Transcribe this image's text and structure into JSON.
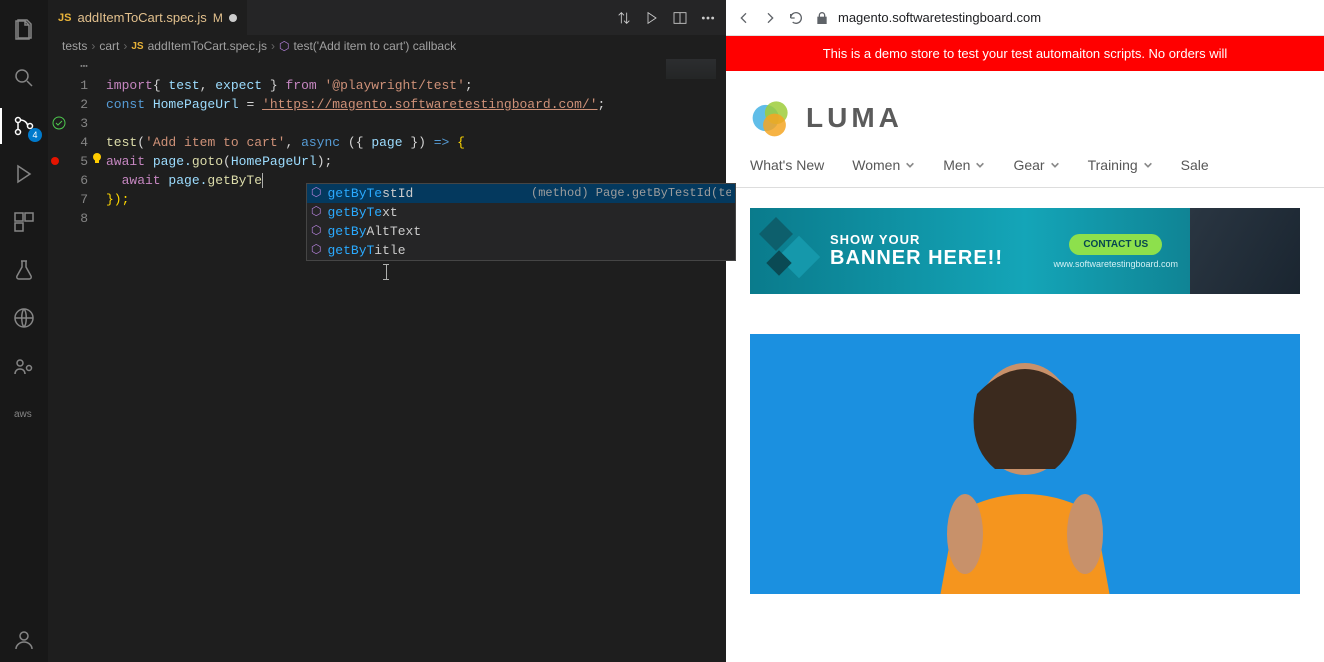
{
  "editor": {
    "tab": {
      "filename": "addItemToCart.spec.js",
      "modified_marker": "M"
    },
    "breadcrumb": {
      "parts": [
        "tests",
        "cart",
        "addItemToCart.spec.js",
        "test('Add item to cart') callback"
      ]
    },
    "line_numbers": [
      "1",
      "2",
      "3",
      "4",
      "5",
      "6",
      "7",
      "8"
    ],
    "code": {
      "l1_import": "import",
      "l1_brace_open": "{ ",
      "l1_test": "test",
      "l1_comma": ", ",
      "l1_expect": "expect",
      "l1_brace_close": " }",
      "l1_from": " from ",
      "l1_pkg": "'@playwright/test'",
      "l1_semi": ";",
      "l2_const": "const",
      "l2_var": " HomePageUrl ",
      "l2_eq": "= ",
      "l2_url": "'https://magento.softwaretestingboard.com/'",
      "l2_semi": ";",
      "l4_test": "test",
      "l4_open": "(",
      "l4_name": "'Add item to cart'",
      "l4_comma": ", ",
      "l4_async": "async",
      "l4_args": " ({ ",
      "l4_page": "page",
      "l4_args2": " }) ",
      "l4_arrow": "=>",
      "l4_brace": " {",
      "l5_await": "await",
      "l5_page": " page.",
      "l5_goto": "goto",
      "l5_open": "(",
      "l5_arg": "HomePageUrl",
      "l5_close": ");",
      "l6_await": "  await",
      "l6_page": " page.",
      "l6_method": "getByTe",
      "l7_close": "});"
    },
    "suggestions": {
      "items": [
        {
          "prefix": "getByTe",
          "suffix": "stId",
          "doc": "(method) Page.getByTestId(testId: string …"
        },
        {
          "prefix": "getByTe",
          "suffix": "xt",
          "doc": ""
        },
        {
          "prefix": "getBy",
          "mid": "AltTe",
          "suffix": "xt",
          "doc": ""
        },
        {
          "prefix": "getByT",
          "mid": "i",
          "suffix": "tle",
          "doc": ""
        }
      ]
    },
    "badges": {
      "source_control": "4"
    }
  },
  "browser": {
    "url": "magento.softwaretestingboard.com",
    "demo_banner": "This is a demo store to test your test automaiton scripts. No orders will",
    "logo_text": "LUMA",
    "nav": {
      "whats_new": "What's New",
      "women": "Women",
      "men": "Men",
      "gear": "Gear",
      "training": "Training",
      "sale": "Sale"
    },
    "promo": {
      "line1": "SHOW YOUR",
      "line2": "BANNER HERE!!",
      "cta": "CONTACT US",
      "url": "www.softwaretestingboard.com"
    }
  }
}
